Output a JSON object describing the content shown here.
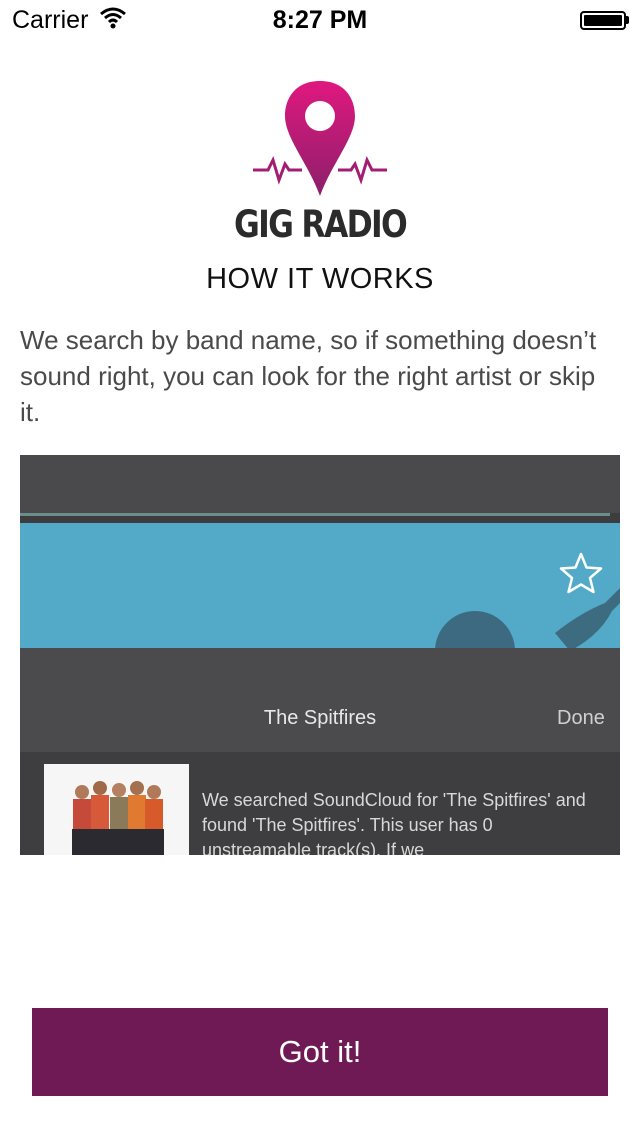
{
  "status_bar": {
    "carrier": "Carrier",
    "time": "8:27 PM",
    "icons": [
      "wifi-icon",
      "battery-icon"
    ]
  },
  "brand": {
    "name": "GIG RADIO",
    "logo_icon": "location-pin-pulse-icon",
    "accent_colors": [
      "#e0187f",
      "#9b1f6e"
    ]
  },
  "heading": "HOW IT WORKS",
  "description": "We search by band name, so if something doesn’t sound right, you can look for the right artist or skip it.",
  "preview": {
    "title": "The Spitfires",
    "done_label": "Done",
    "text": "We searched SoundCloud for 'The Spitfires' and found 'The Spitfires'. This user has 0 unstreamable track(s). If we",
    "banner_color": "#52aac8",
    "star_icon": "star-outline-icon"
  },
  "button": {
    "label": "Got it!",
    "color": "#6f1a55"
  }
}
